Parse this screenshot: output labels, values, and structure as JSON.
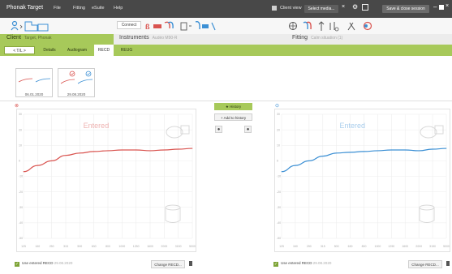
{
  "titlebar": {
    "app_name": "Phonak Target",
    "menu": [
      "File",
      "Fitting",
      "eSuite",
      "Help"
    ],
    "client_view": "Client view",
    "select_media": "Select media...",
    "save_close": "Save & close session"
  },
  "toolbar": {
    "connect": "Connect"
  },
  "header": {
    "client": "Client",
    "client_name": "Target, Phonak",
    "instruments": "Instruments",
    "instruments_sub": "Audéo M90-R",
    "fitting": "Fitting",
    "fitting_sub": "Calm situation (1)"
  },
  "tabs": [
    "Details",
    "Audiogram",
    "RECD",
    "REUG"
  ],
  "active_tab": "RECD",
  "nav_label": "< T/L >",
  "sessions": [
    {
      "date": "06.01.2020"
    },
    {
      "date": "29.08.2020"
    }
  ],
  "left_ear": {
    "label": "R",
    "status": "Entered",
    "color": "#d9534f",
    "use_label": "Use entered RECD",
    "use_date": "29.08.2020",
    "change_label": "Change RECD..."
  },
  "right_ear": {
    "label": "L",
    "status": "Entered",
    "color": "#3b8fd4",
    "use_label": "Use entered RECD",
    "use_date": "29.08.2020",
    "change_label": "Change RECD..."
  },
  "history": {
    "history_label": "History",
    "add_label": "Add to history"
  },
  "chart_data": [
    {
      "type": "line",
      "series": [
        {
          "values": [
            -7,
            -3,
            0,
            3.5,
            5,
            6,
            6.5,
            7,
            7,
            6.5,
            7,
            7.5,
            8
          ]
        }
      ],
      "x": [
        125,
        160,
        250,
        315,
        500,
        630,
        800,
        1000,
        1250,
        1600,
        2000,
        3150,
        5000
      ],
      "ylim": [
        -50,
        30
      ]
    },
    {
      "type": "line",
      "series": [
        {
          "values": [
            -7,
            -3,
            0,
            3,
            5,
            5.5,
            6,
            6.5,
            7,
            7,
            6.5,
            7.5,
            8
          ]
        }
      ],
      "x": [
        125,
        160,
        250,
        315,
        500,
        630,
        800,
        1000,
        1250,
        1600,
        2000,
        3150,
        5000
      ],
      "ylim": [
        -50,
        30
      ]
    }
  ]
}
